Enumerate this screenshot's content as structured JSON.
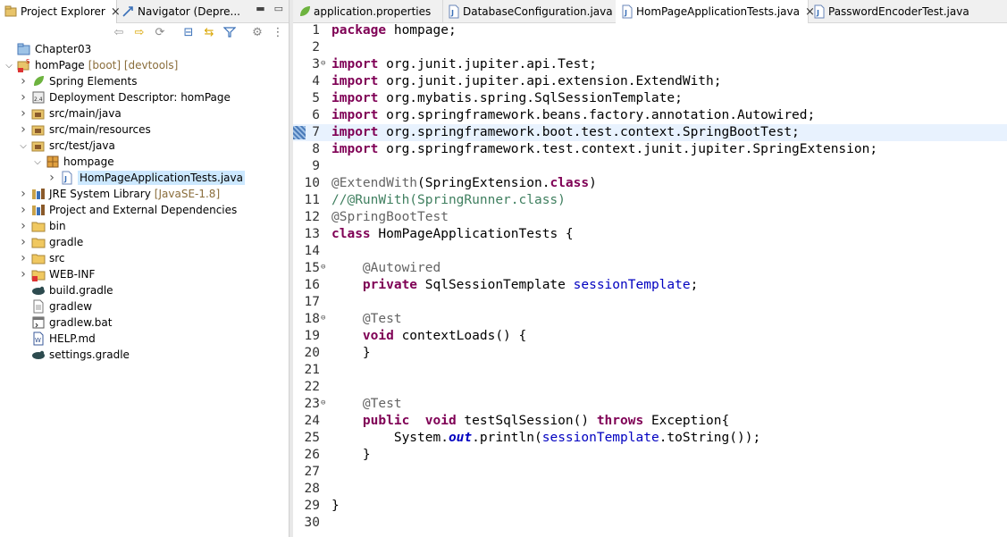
{
  "left_pane": {
    "tabs": [
      {
        "label": "Project Explorer",
        "close": "×"
      },
      {
        "label": "Navigator (Depre..."
      }
    ],
    "window_controls": [
      "minimize-icon",
      "maximize-icon"
    ]
  },
  "tree": [
    {
      "label": "Chapter03",
      "icon": "working-set-icon",
      "depth": 0,
      "twisty": ""
    },
    {
      "label": "homPage",
      "decoration": "[boot] [devtools]",
      "icon": "project-icon",
      "depth": 0,
      "twisty": "expanded"
    },
    {
      "label": "Spring Elements",
      "icon": "spring-leaf-icon",
      "depth": 1,
      "twisty": "collapsed"
    },
    {
      "label": "Deployment Descriptor: homPage",
      "icon": "deployment-descriptor-icon",
      "depth": 1,
      "twisty": "collapsed"
    },
    {
      "label": "src/main/java",
      "icon": "source-folder-icon",
      "depth": 1,
      "twisty": "collapsed"
    },
    {
      "label": "src/main/resources",
      "icon": "source-folder-icon",
      "depth": 1,
      "twisty": "collapsed"
    },
    {
      "label": "src/test/java",
      "icon": "source-folder-icon",
      "depth": 1,
      "twisty": "expanded"
    },
    {
      "label": "hompage",
      "icon": "package-icon",
      "depth": 2,
      "twisty": "expanded"
    },
    {
      "label": "HomPageApplicationTests.java",
      "icon": "java-file-icon",
      "depth": 3,
      "twisty": "collapsed",
      "selected": true
    },
    {
      "label": "JRE System Library",
      "decoration": "[JavaSE-1.8]",
      "icon": "library-icon",
      "depth": 1,
      "twisty": "collapsed"
    },
    {
      "label": "Project and External Dependencies",
      "icon": "library-icon",
      "depth": 1,
      "twisty": "collapsed"
    },
    {
      "label": "bin",
      "icon": "folder-icon",
      "depth": 1,
      "twisty": "collapsed"
    },
    {
      "label": "gradle",
      "icon": "folder-icon",
      "depth": 1,
      "twisty": "collapsed"
    },
    {
      "label": "src",
      "icon": "folder-icon",
      "depth": 1,
      "twisty": "collapsed"
    },
    {
      "label": "WEB-INF",
      "icon": "folder-error-icon",
      "depth": 1,
      "twisty": "collapsed"
    },
    {
      "label": "build.gradle",
      "icon": "gradle-icon",
      "depth": 1,
      "twisty": ""
    },
    {
      "label": "gradlew",
      "icon": "text-file-icon",
      "depth": 1,
      "twisty": ""
    },
    {
      "label": "gradlew.bat",
      "icon": "bat-file-icon",
      "depth": 1,
      "twisty": ""
    },
    {
      "label": "HELP.md",
      "icon": "word-file-icon",
      "depth": 1,
      "twisty": ""
    },
    {
      "label": "settings.gradle",
      "icon": "gradle-icon",
      "depth": 1,
      "twisty": ""
    }
  ],
  "editor": {
    "tabs": [
      {
        "label": "application.properties",
        "icon": "properties-file-icon"
      },
      {
        "label": "DatabaseConfiguration.java",
        "icon": "java-file-icon"
      },
      {
        "label": "HomPageApplicationTests.java",
        "icon": "java-file-icon",
        "active": true,
        "close": "×"
      },
      {
        "label": "PasswordEncoderTest.java",
        "icon": "java-file-icon"
      }
    ],
    "current_line": 7,
    "lines": [
      {
        "n": "1",
        "tokens": [
          [
            "kw",
            "package"
          ],
          [
            "",
            "hompage;"
          ]
        ]
      },
      {
        "n": "2",
        "tokens": []
      },
      {
        "n": "3",
        "fold": "⊖",
        "tokens": [
          [
            "kw",
            "import"
          ],
          [
            "",
            "org.junit.jupiter.api.Test;"
          ]
        ]
      },
      {
        "n": "4",
        "tokens": [
          [
            "kw",
            "import"
          ],
          [
            "",
            "org.junit.jupiter.api.extension.ExtendWith;"
          ]
        ]
      },
      {
        "n": "5",
        "tokens": [
          [
            "kw",
            "import"
          ],
          [
            "",
            "org.mybatis.spring.SqlSessionTemplate;"
          ]
        ]
      },
      {
        "n": "6",
        "tokens": [
          [
            "kw",
            "import"
          ],
          [
            "",
            "org.springframework.beans.factory.annotation.Autowired;"
          ]
        ]
      },
      {
        "n": "7",
        "tokens": [
          [
            "kw",
            "import"
          ],
          [
            "",
            "org.springframework.boot.test.context.SpringBootTest;"
          ]
        ]
      },
      {
        "n": "8",
        "tokens": [
          [
            "kw",
            "import"
          ],
          [
            "",
            "org.springframework.test.context.junit.jupiter.SpringExtension;"
          ]
        ]
      },
      {
        "n": "9",
        "tokens": []
      },
      {
        "n": "10",
        "tokens": [
          [
            "ann",
            "@ExtendWith"
          ],
          [
            "",
            "(SpringExtension."
          ],
          [
            "kw",
            "class"
          ],
          [
            "",
            ")"
          ]
        ]
      },
      {
        "n": "11",
        "tokens": [
          [
            "cmt",
            "//@RunWith(SpringRunner.class)"
          ]
        ]
      },
      {
        "n": "12",
        "tokens": [
          [
            "ann",
            "@SpringBootTest"
          ]
        ]
      },
      {
        "n": "13",
        "tokens": [
          [
            "kw",
            "class"
          ],
          [
            "",
            " HomPageApplicationTests {"
          ]
        ]
      },
      {
        "n": "14",
        "tokens": []
      },
      {
        "n": "15",
        "fold": "⊖",
        "tokens": [
          [
            "",
            "    "
          ],
          [
            "ann",
            "@Autowired"
          ]
        ]
      },
      {
        "n": "16",
        "tokens": [
          [
            "",
            "    "
          ],
          [
            "kw",
            "private"
          ],
          [
            "",
            " SqlSessionTemplate "
          ],
          [
            "fld",
            "sessionTemplate"
          ],
          [
            "",
            ";"
          ]
        ]
      },
      {
        "n": "17",
        "tokens": []
      },
      {
        "n": "18",
        "fold": "⊖",
        "tokens": [
          [
            "",
            "    "
          ],
          [
            "ann",
            "@Test"
          ]
        ]
      },
      {
        "n": "19",
        "tokens": [
          [
            "",
            "    "
          ],
          [
            "kw",
            "void"
          ],
          [
            "",
            " contextLoads() {"
          ]
        ]
      },
      {
        "n": "20",
        "tokens": [
          [
            "",
            "    }"
          ]
        ]
      },
      {
        "n": "21",
        "tokens": []
      },
      {
        "n": "22",
        "tokens": []
      },
      {
        "n": "23",
        "fold": "⊖",
        "tokens": [
          [
            "",
            "    "
          ],
          [
            "ann",
            "@Test"
          ]
        ]
      },
      {
        "n": "24",
        "tokens": [
          [
            "",
            "    "
          ],
          [
            "kw",
            "public"
          ],
          [
            "",
            ""
          ],
          [
            "kw",
            " void"
          ],
          [
            "",
            " testSqlSession() "
          ],
          [
            "kw",
            "throws"
          ],
          [
            "",
            " Exception{"
          ]
        ]
      },
      {
        "n": "25",
        "tokens": [
          [
            "",
            "        System."
          ],
          [
            "st",
            "out"
          ],
          [
            "",
            ".println("
          ],
          [
            "fld",
            "sessionTemplate"
          ],
          [
            "",
            ".toString());"
          ]
        ]
      },
      {
        "n": "26",
        "tokens": [
          [
            "",
            "    }"
          ]
        ]
      },
      {
        "n": "27",
        "tokens": []
      },
      {
        "n": "28",
        "tokens": []
      },
      {
        "n": "29",
        "tokens": [
          [
            "",
            "}"
          ]
        ]
      },
      {
        "n": "30",
        "tokens": []
      }
    ]
  },
  "colors": {
    "keyword": "#7f0055",
    "annotation": "#646464",
    "comment": "#3f7f5f",
    "field": "#0000c0",
    "selection": "#cce8ff",
    "current_line": "#e8f2fe"
  }
}
